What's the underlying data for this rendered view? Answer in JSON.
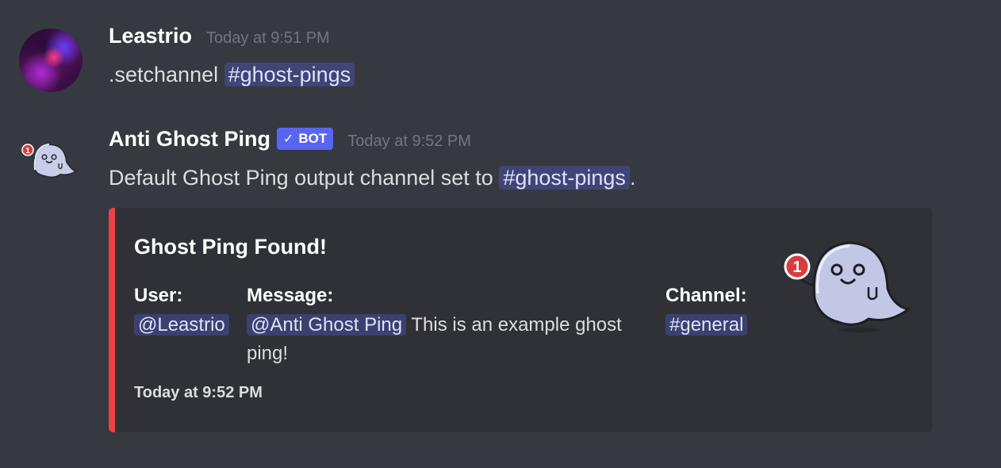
{
  "messages": [
    {
      "author": "Leastrio",
      "timestamp": "Today at 9:51 PM",
      "content_text": ".setchannel ",
      "content_mention": "#ghost-pings"
    },
    {
      "author": "Anti Ghost Ping",
      "bot_tag": "BOT",
      "timestamp": "Today at 9:52 PM",
      "content_text": "Default Ghost Ping output channel set to ",
      "content_mention": "#ghost-pings",
      "content_suffix": ".",
      "embed": {
        "accent_color": "#ed4245",
        "title": "Ghost Ping Found!",
        "fields": {
          "user": {
            "name": "User:",
            "value": "@Leastrio"
          },
          "message": {
            "name": "Message:",
            "mention": "@Anti Ghost Ping",
            "text": " This is an example ghost ping!"
          },
          "channel": {
            "name": "Channel:",
            "value": "#general"
          }
        },
        "footer": "Today at 9:52 PM",
        "thumbnail_badge": "1"
      }
    }
  ],
  "colors": {
    "background": "#36393f",
    "embed_background": "#2f3136",
    "bot_tag": "#5865f2",
    "mention_bg": "#414675",
    "notification_red": "#d83c3e"
  }
}
